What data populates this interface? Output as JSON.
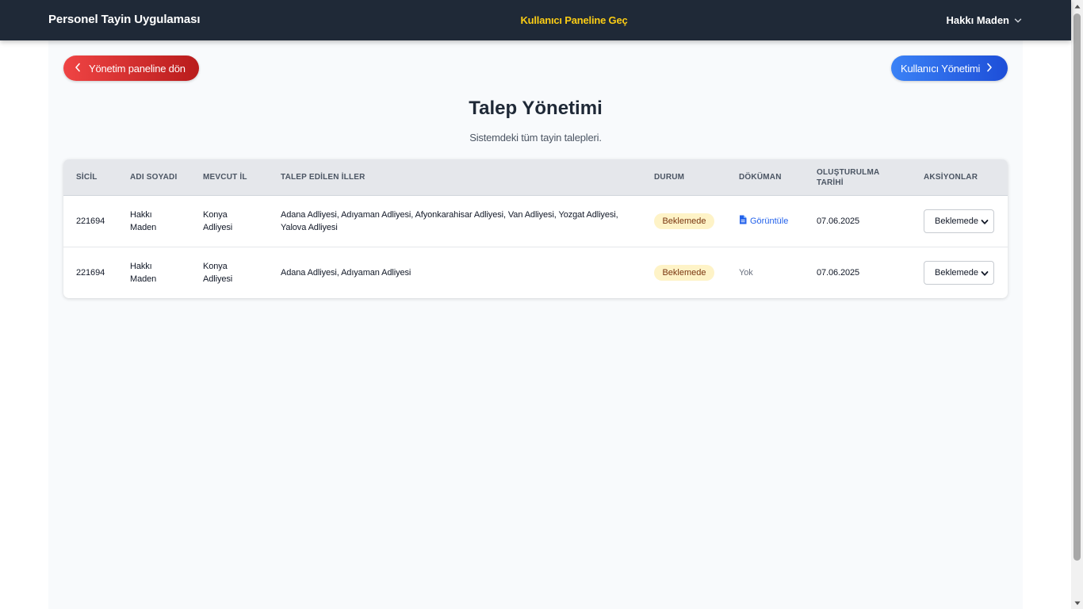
{
  "navbar": {
    "brand": "Personel Tayin Uygulaması",
    "switch_link": "Kullanıcı Paneline Geç",
    "user_name": "Hakkı Maden",
    "user_menu_icon": "chevron-down-icon"
  },
  "actions": {
    "back_label": "Yönetim paneline dön",
    "back_icon": "chevron-left-icon",
    "users_label": "Kullanıcı Yönetimi",
    "users_icon": "chevron-right-icon"
  },
  "page": {
    "title": "Talep Yönetimi",
    "subtitle": "Sistemdeki tüm tayin talepleri."
  },
  "table": {
    "headers": {
      "sicil": "SİCİL",
      "name": "ADI SOYADI",
      "current": "MEVCUT İL",
      "requested": "TALEP EDİLEN İLLER",
      "status": "DURUM",
      "document": "DÖKÜMAN",
      "created_line1": "OLUŞTURULMA",
      "created_line2": "TARİHİ",
      "actions": "AKSİYONLAR"
    },
    "rows": [
      {
        "sicil": "221694",
        "name_line1": "Hakkı",
        "name_line2": "Maden",
        "current_line1": "Konya",
        "current_line2": "Adliyesi",
        "requested_line1": "Adana Adliyesi, Adıyaman Adliyesi, Afyonkarahisar Adliyesi, Van Adliyesi, Yozgat Adliyesi,",
        "requested_line2": "Yalova Adliyesi",
        "status": "Beklemede",
        "document": "Görüntüle",
        "document_icon": "document-icon",
        "created": "07.06.2025",
        "action_value": "Beklemede"
      },
      {
        "sicil": "221694",
        "name_line1": "Hakkı",
        "name_line2": "Maden",
        "current_line1": "Konya",
        "current_line2": "Adliyesi",
        "requested_line1": "Adana Adliyesi, Adıyaman Adliyesi",
        "status": "Beklemede",
        "document": "Yok",
        "created": "07.06.2025",
        "action_value": "Beklemede"
      }
    ]
  },
  "colors": {
    "navbar_bg": "#1f2937",
    "nav_link": "#facc15",
    "back_button": "#ef4444",
    "users_button": "#3b82f6",
    "status_badge_bg": "#fef3c7",
    "status_badge_text": "#78350f",
    "link_blue": "#2563eb"
  }
}
